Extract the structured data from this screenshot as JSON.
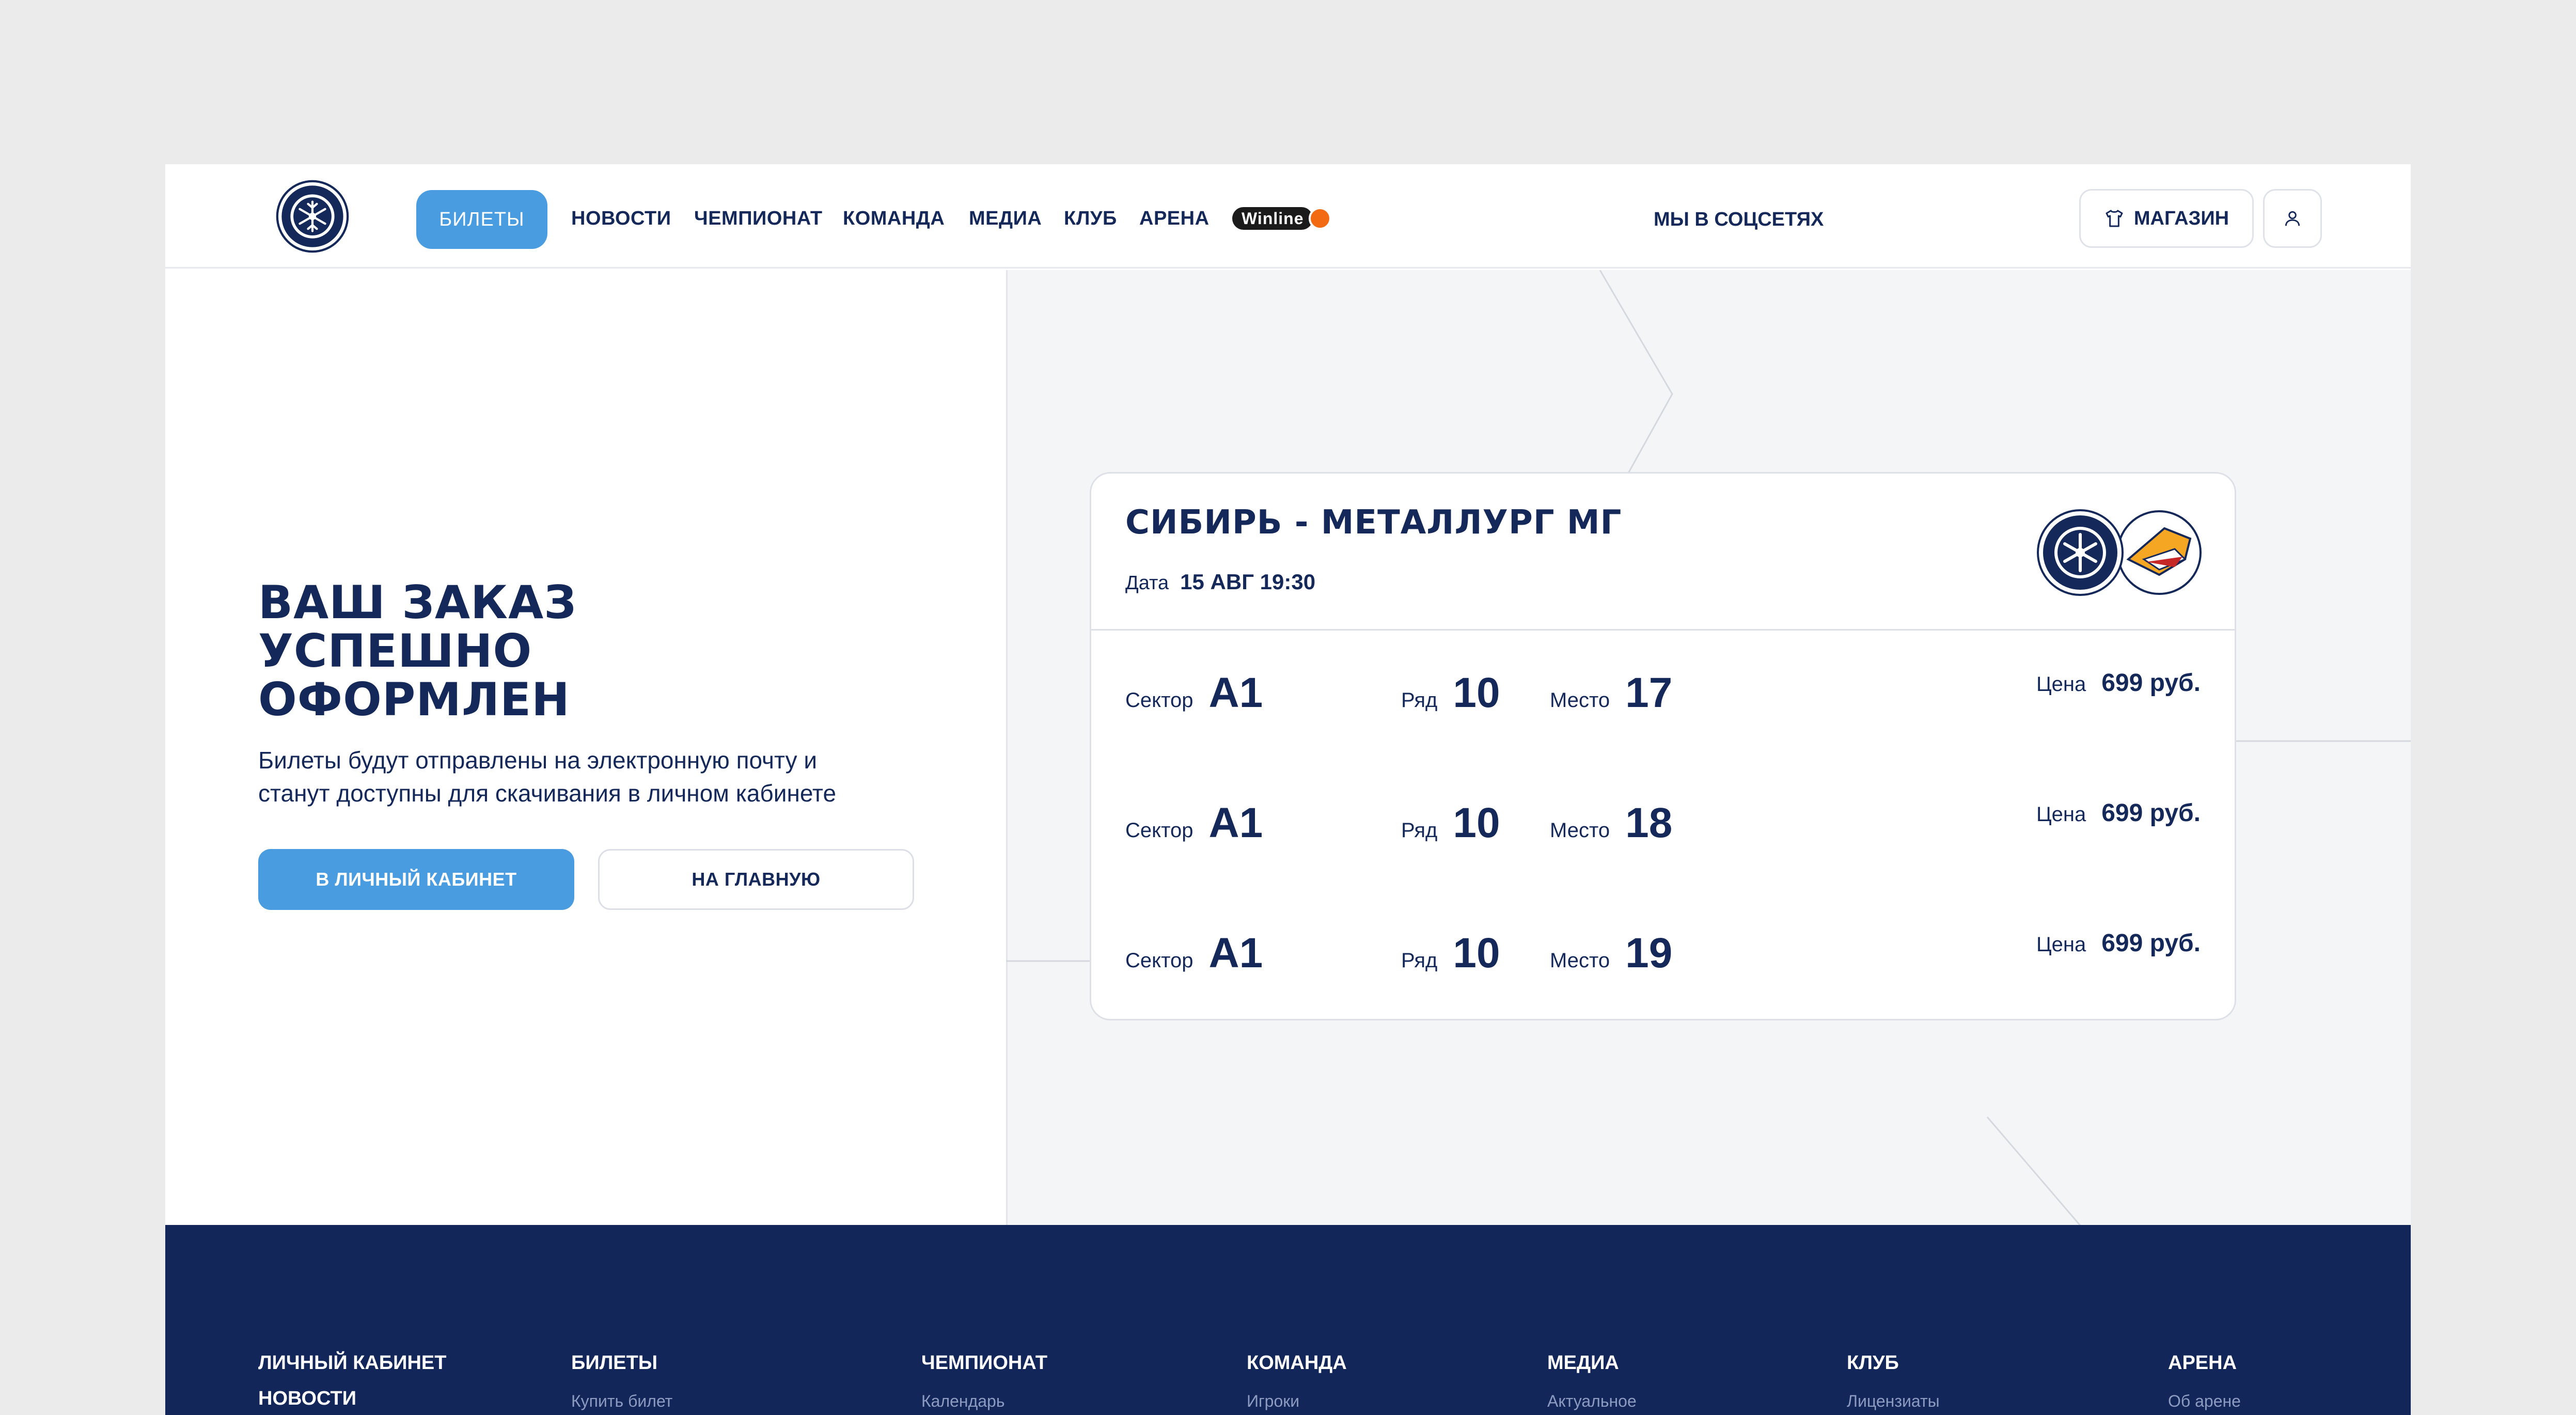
{
  "header": {
    "nav_active": "БИЛЕТЫ",
    "nav": [
      "НОВОСТИ",
      "ЧЕМПИОНАТ",
      "КОМАНДА",
      "МЕДИА",
      "КЛУБ",
      "АРЕНА"
    ],
    "winline": "Winline",
    "socials": "МЫ В СОЦСЕТЯХ",
    "shop": "МАГАЗИН"
  },
  "main": {
    "title_lines": [
      "ВАШ ЗАКАЗ",
      "УСПЕШНО",
      "ОФОРМЛЕН"
    ],
    "subtitle_lines": [
      "Билеты будут отправлены на электронную почту и",
      "станут доступны для скачивания в личном кабинете"
    ],
    "btn_cabinet": "В ЛИЧНЫЙ КАБИНЕТ",
    "btn_home": "НА ГЛАВНУЮ"
  },
  "ticket": {
    "match": "СИБИРЬ - МЕТАЛЛУРГ МГ",
    "date_label": "Дата",
    "date_value": "15 АВГ 19:30",
    "labels": {
      "sector": "Сектор",
      "row": "Ряд",
      "seat": "Место",
      "price": "Цена"
    },
    "seats": [
      {
        "sector": "A1",
        "row": "10",
        "seat": "17",
        "price": "699 руб."
      },
      {
        "sector": "A1",
        "row": "10",
        "seat": "18",
        "price": "699 руб."
      },
      {
        "sector": "A1",
        "row": "10",
        "seat": "19",
        "price": "699 руб."
      }
    ]
  },
  "footer": {
    "columns": [
      {
        "head": "ЛИЧНЫЙ КАБИНЕТ",
        "head2": "НОВОСТИ"
      },
      {
        "head": "БИЛЕТЫ",
        "sub": "Купить билет"
      },
      {
        "head": "ЧЕМПИОНАТ",
        "sub": "Календарь"
      },
      {
        "head": "КОМАНДА",
        "sub": "Игроки"
      },
      {
        "head": "МЕДИА",
        "sub": "Актуальное"
      },
      {
        "head": "КЛУБ",
        "sub": "Лицензиаты"
      },
      {
        "head": "АРЕНА",
        "sub": "Об арене"
      }
    ]
  },
  "colors": {
    "primary": "#4a9ce0",
    "navy": "#13265a",
    "winline_orange": "#f26a12"
  },
  "icons": [
    "sibir-logo",
    "shirt-icon",
    "user-icon",
    "metallurg-logo"
  ]
}
